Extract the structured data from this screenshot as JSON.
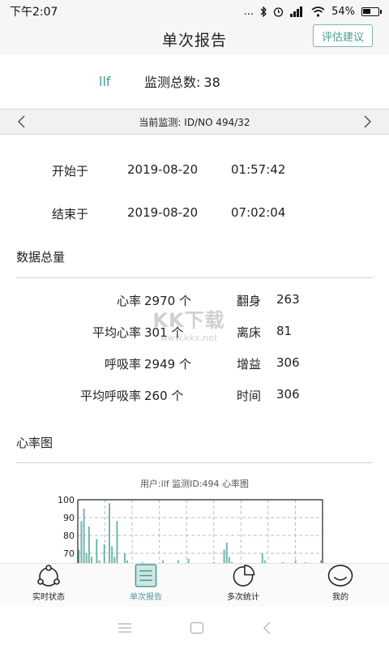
{
  "status_bar": {
    "time": "下午2:07",
    "signal_text": "...",
    "battery": "54%"
  },
  "header": {
    "title": "单次报告",
    "eval_button": "评估建议"
  },
  "summary": {
    "user": "llf",
    "count_label": "监测总数:",
    "count_value": "38"
  },
  "monitor_bar": {
    "label": "当前监测: ID/NO 494/32"
  },
  "times": {
    "start": {
      "label": "开始于",
      "date": "2019-08-20",
      "time": "01:57:42"
    },
    "end": {
      "label": "结束于",
      "date": "2019-08-20",
      "time": "07:02:04"
    }
  },
  "data_section": {
    "title": "数据总量",
    "rows": [
      {
        "left_label": "心率",
        "left_value": "2970 个",
        "right_label": "翻身",
        "right_value": "263"
      },
      {
        "left_label": "平均心率",
        "left_value": "301 个",
        "right_label": "离床",
        "right_value": "81"
      },
      {
        "left_label": "呼吸率",
        "left_value": "2949 个",
        "right_label": "增益",
        "right_value": "306"
      },
      {
        "left_label": "平均呼吸率",
        "left_value": "260 个",
        "right_label": "时间",
        "right_value": "306"
      }
    ]
  },
  "watermark": {
    "big": "KK下载",
    "small": "www.kkx.net"
  },
  "heart_section": {
    "title": "心率图"
  },
  "chart_data": {
    "type": "bar",
    "title": "用户:llf   监测ID:494   心率图",
    "ylim": [
      60,
      100
    ],
    "yticks": [
      100,
      90,
      80,
      70
    ],
    "grid": true,
    "values": [
      72,
      88,
      95,
      70,
      85,
      68,
      62,
      78,
      66,
      61,
      75,
      64,
      98,
      74,
      68,
      88,
      63,
      61,
      70,
      66,
      62,
      64,
      61,
      62,
      60,
      65,
      61,
      63,
      60,
      62,
      64,
      61,
      60,
      66,
      61,
      60,
      63,
      62,
      64,
      66,
      62,
      61,
      60,
      67,
      61,
      60,
      62,
      63,
      61,
      64,
      60,
      62,
      61,
      65,
      61,
      60,
      63,
      72,
      76,
      68,
      65,
      62,
      61,
      60,
      62,
      61,
      60,
      63,
      61,
      60,
      62,
      61,
      70,
      66,
      60,
      62,
      61,
      60,
      63,
      61,
      65,
      62,
      60,
      61,
      64,
      66,
      61,
      60,
      62,
      65,
      61,
      63,
      60,
      62,
      61,
      66
    ]
  },
  "tabs": [
    {
      "label": "实时状态",
      "icon": "share-circle-icon"
    },
    {
      "label": "单次报告",
      "icon": "report-icon",
      "active": true
    },
    {
      "label": "多次统计",
      "icon": "pie-chart-icon"
    },
    {
      "label": "我的",
      "icon": "smiley-icon"
    }
  ],
  "colors": {
    "accent": "#4d9b95",
    "bar": "#6fb3ad"
  }
}
